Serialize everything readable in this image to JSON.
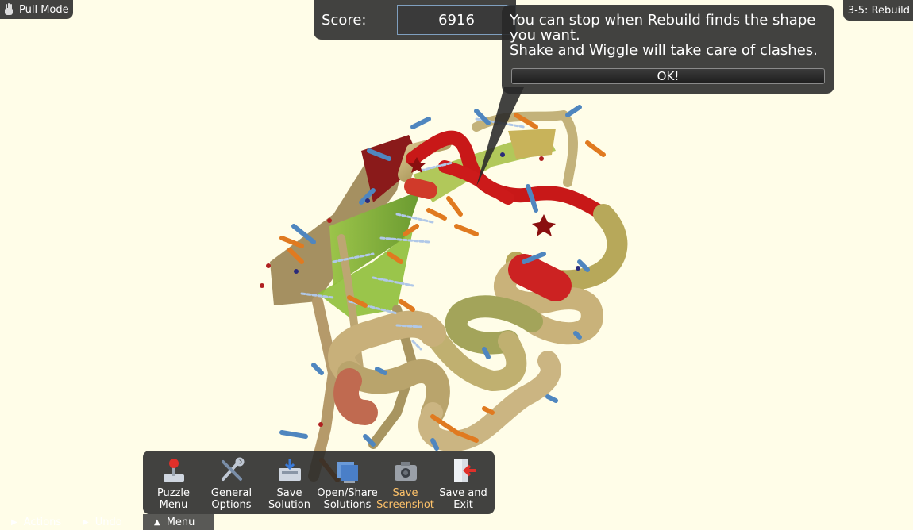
{
  "mode_badge": {
    "label": "Pull Mode",
    "icon": "hand-icon"
  },
  "level_badge": {
    "label": "3-5: Rebuild"
  },
  "score": {
    "label": "Score:",
    "value": "6916"
  },
  "tip": {
    "line1": "You can stop when Rebuild finds the shape you want.",
    "line2": "Shake and Wiggle will take care of clashes.",
    "ok_label": "OK!"
  },
  "menu": {
    "items": [
      {
        "label1": "Puzzle",
        "label2": "Menu",
        "icon": "joystick-icon"
      },
      {
        "label1": "General",
        "label2": "Options",
        "icon": "tools-icon"
      },
      {
        "label1": "Save",
        "label2": "Solution",
        "icon": "save-icon"
      },
      {
        "label1": "Open/Share",
        "label2": "Solutions",
        "icon": "folder-icon"
      },
      {
        "label1": "Save",
        "label2": "Screenshot",
        "icon": "camera-icon"
      },
      {
        "label1": "Save and",
        "label2": "Exit",
        "icon": "exit-door-icon"
      }
    ]
  },
  "bottom": {
    "actions_label": "Actions",
    "undo_label": "Undo",
    "menu_label": "Menu"
  },
  "colors": {
    "background": "#fffde8",
    "panel": "#282828",
    "highlight": "#ffc36a",
    "backbone_red": "#cc1a1a",
    "sheet_green": "#7fae3a",
    "coil_tan": "#c9b07a",
    "sidechain_blue": "#4f86bf",
    "sidechain_orange": "#e07a20"
  }
}
